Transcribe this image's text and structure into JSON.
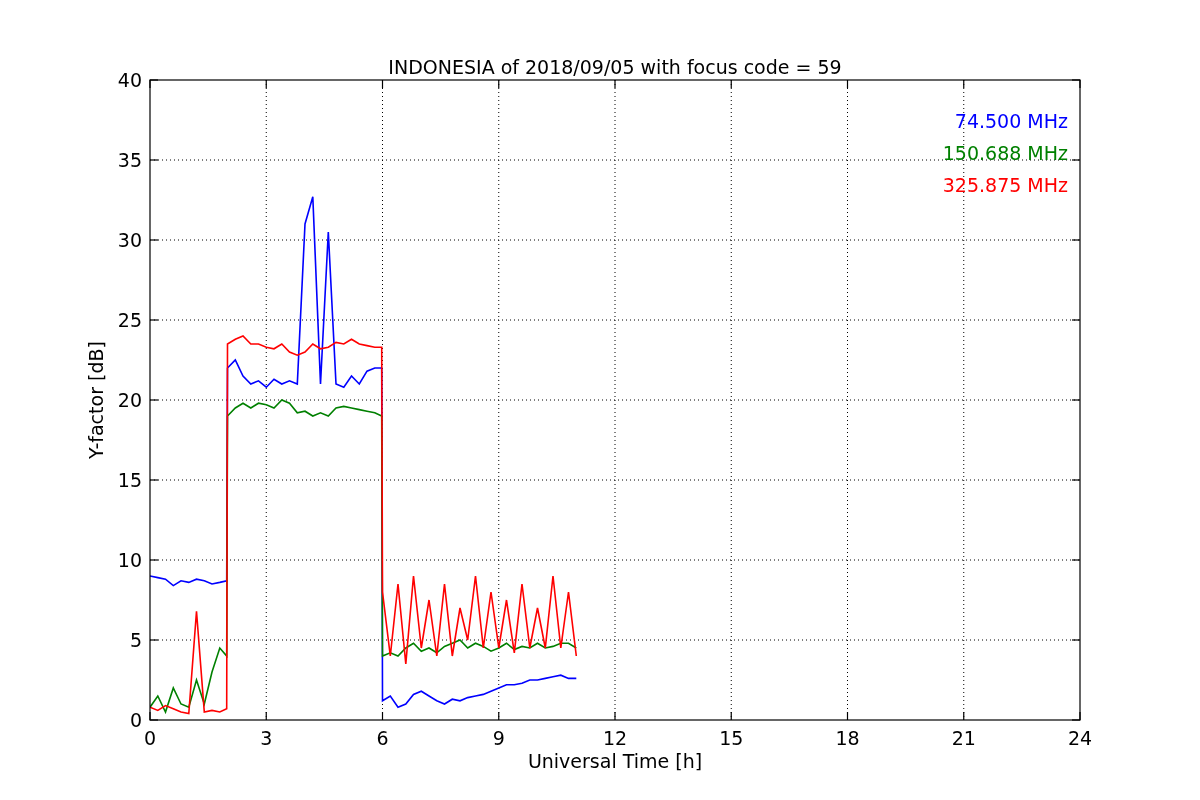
{
  "figure": {
    "chart_data": {
      "type": "line",
      "title": "INDONESIA of 2018/09/05 with focus code = 59",
      "xlabel": "Universal Time [h]",
      "ylabel": "Y-factor [dB]",
      "x": [
        0,
        0.2,
        0.4,
        0.6,
        0.8,
        1.0,
        1.2,
        1.4,
        1.6,
        1.8,
        1.98,
        2.0,
        2.2,
        2.4,
        2.6,
        2.8,
        3.0,
        3.2,
        3.4,
        3.6,
        3.8,
        4.0,
        4.2,
        4.4,
        4.6,
        4.8,
        5.0,
        5.2,
        5.4,
        5.6,
        5.8,
        5.98,
        6.0,
        6.2,
        6.4,
        6.6,
        6.8,
        7.0,
        7.2,
        7.4,
        7.6,
        7.8,
        8.0,
        8.2,
        8.4,
        8.6,
        8.8,
        9.0,
        9.2,
        9.4,
        9.6,
        9.8,
        10.0,
        10.2,
        10.4,
        10.6,
        10.8,
        11.0
      ],
      "series": [
        {
          "name": "74.500 MHz",
          "color": "#0000ff",
          "values": [
            9,
            8.9,
            8.8,
            8.4,
            8.7,
            8.6,
            8.8,
            8.7,
            8.5,
            8.6,
            8.7,
            22,
            22.5,
            21.5,
            21,
            21.2,
            20.8,
            21.3,
            21,
            21.2,
            21,
            31,
            32.7,
            21,
            30.5,
            21,
            20.8,
            21.5,
            21,
            21.8,
            22,
            22,
            1.2,
            1.5,
            0.8,
            1.0,
            1.6,
            1.8,
            1.5,
            1.2,
            1.0,
            1.3,
            1.2,
            1.4,
            1.5,
            1.6,
            1.8,
            2.0,
            2.2,
            2.2,
            2.3,
            2.5,
            2.5,
            2.6,
            2.7,
            2.8,
            2.6,
            2.6
          ]
        },
        {
          "name": "150.688 MHz",
          "color": "#008000",
          "values": [
            0.8,
            1.5,
            0.5,
            2,
            1,
            0.8,
            2.5,
            1,
            3,
            4.5,
            4,
            19,
            19.5,
            19.8,
            19.5,
            19.8,
            19.7,
            19.5,
            20,
            19.8,
            19.2,
            19.3,
            19,
            19.2,
            19,
            19.5,
            19.6,
            19.5,
            19.4,
            19.3,
            19.2,
            19,
            4,
            4.2,
            4,
            4.5,
            4.8,
            4.3,
            4.5,
            4.2,
            4.6,
            4.8,
            5,
            4.5,
            4.8,
            4.6,
            4.3,
            4.5,
            4.8,
            4.4,
            4.6,
            4.5,
            4.8,
            4.5,
            4.6,
            4.8,
            4.8,
            4.5
          ]
        },
        {
          "name": "325.875 MHz",
          "color": "#ff0000",
          "values": [
            0.8,
            0.6,
            0.9,
            0.7,
            0.5,
            0.4,
            6.8,
            0.5,
            0.6,
            0.5,
            0.7,
            23.5,
            23.8,
            24,
            23.5,
            23.5,
            23.3,
            23.2,
            23.5,
            23,
            22.8,
            23,
            23.5,
            23.2,
            23.3,
            23.6,
            23.5,
            23.8,
            23.5,
            23.4,
            23.3,
            23.3,
            8,
            4,
            8.5,
            3.5,
            9,
            4.5,
            7.5,
            4,
            8.5,
            4,
            7,
            5,
            9,
            4.5,
            8,
            4.5,
            7.5,
            4.2,
            8.5,
            4.5,
            7,
            4.5,
            9,
            4.5,
            8,
            4
          ]
        }
      ],
      "grid": true,
      "xlim": [
        0,
        24
      ],
      "ylim": [
        0,
        40
      ],
      "xticks": [
        0,
        3,
        6,
        9,
        12,
        15,
        18,
        21,
        24
      ],
      "yticks": [
        0,
        5,
        10,
        15,
        20,
        25,
        30,
        35,
        40
      ]
    }
  }
}
